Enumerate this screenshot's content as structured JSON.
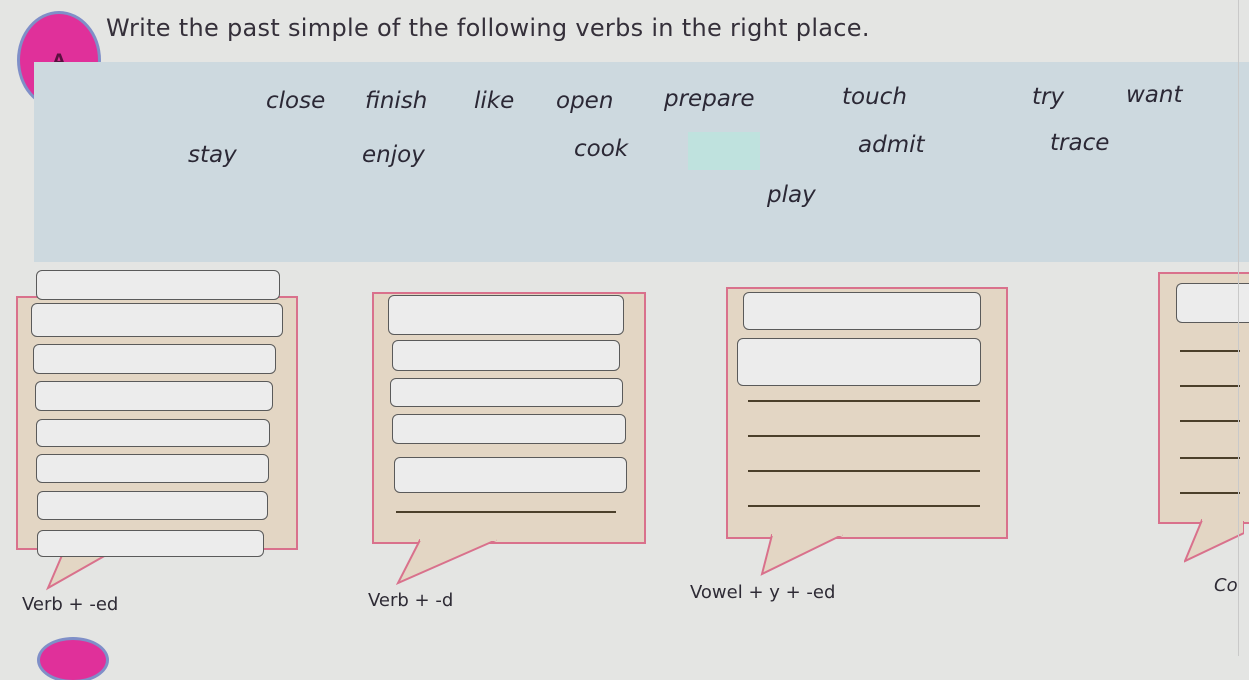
{
  "exercise": {
    "badge_label": "A",
    "instruction": "Write the past simple of the following verbs in the right place."
  },
  "word_bank": {
    "row1": [
      "close",
      "finish",
      "like",
      "open",
      "prepare",
      "touch",
      "try",
      "want"
    ],
    "row2": [
      "stay",
      "enjoy",
      "cook",
      "admit",
      "trace"
    ],
    "row3": [
      "play"
    ]
  },
  "categories": [
    {
      "label": "Verb + -ed",
      "box_count": 8,
      "line_count": 0
    },
    {
      "label": "Verb + -d",
      "box_count": 5,
      "line_count": 1
    },
    {
      "label": "Vowel + y + -ed",
      "box_count": 2,
      "line_count": 4
    },
    {
      "label": "Co",
      "box_count": 1,
      "line_count": 5
    }
  ]
}
